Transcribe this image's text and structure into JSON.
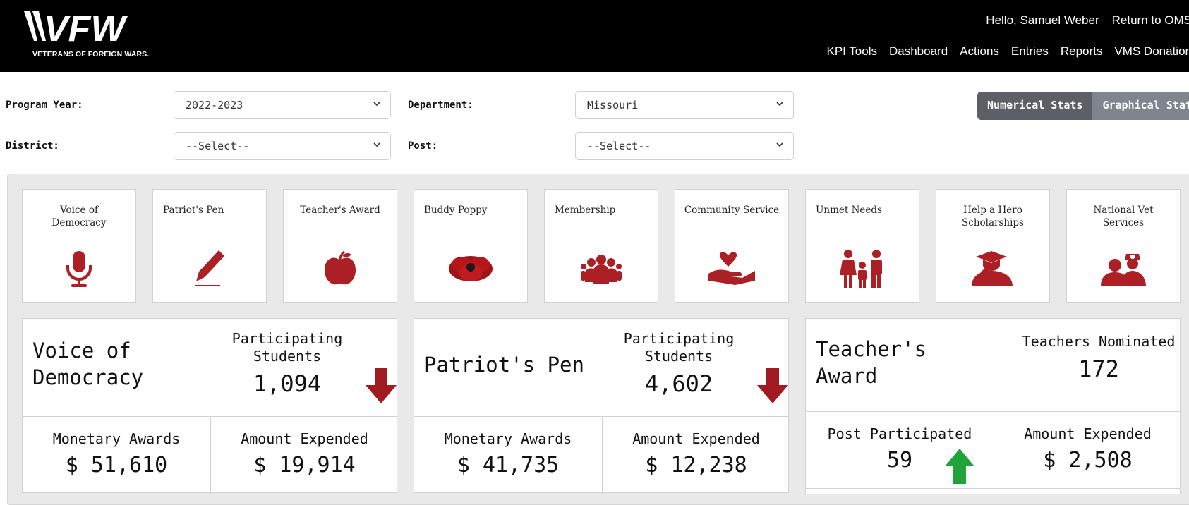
{
  "header": {
    "logo_text": "VFW",
    "logo_subtitle": "VETERANS OF FOREIGN WARS.",
    "user_links": [
      "Hello, Samuel Weber",
      "Return to OMS"
    ],
    "nav": [
      "KPI Tools",
      "Dashboard",
      "Actions",
      "Entries",
      "Reports",
      "VMS Donation"
    ]
  },
  "filters": {
    "program_year_label": "Program Year:",
    "program_year_value": "2022-2023",
    "department_label": "Department:",
    "department_value": "Missouri",
    "district_label": "District:",
    "district_value": "--Select--",
    "post_label": "Post:",
    "post_value": "--Select--"
  },
  "view_toggle": {
    "numerical": "Numerical Stats",
    "graphical": "Graphical Stats",
    "active": "numerical"
  },
  "colors": {
    "accent": "#ab1f25",
    "header_bg": "#000000",
    "panel_bg": "#e9e9e9",
    "up_arrow": "#1fa33a",
    "down_arrow": "#a11a1f"
  },
  "programs": [
    {
      "label": "Voice of Democracy",
      "icon": "microphone-icon"
    },
    {
      "label": "Patriot's Pen",
      "icon": "pen-icon"
    },
    {
      "label": "Teacher's Award",
      "icon": "apple-icon"
    },
    {
      "label": "Buddy Poppy",
      "icon": "poppy-icon"
    },
    {
      "label": "Membership",
      "icon": "group-icon"
    },
    {
      "label": "Community Service",
      "icon": "heart-hand-icon"
    },
    {
      "label": "Unmet Needs",
      "icon": "family-icon"
    },
    {
      "label": "Help a Hero Scholarships",
      "icon": "graduate-salute-icon"
    },
    {
      "label": "National Vet Services",
      "icon": "veteran-nurse-icon"
    }
  ],
  "cards": [
    {
      "title": "Voice of Democracy",
      "metric_label": "Participating Students",
      "metric_value": "1,094",
      "trend": "down",
      "bottom": [
        {
          "label": "Monetary Awards",
          "value": "$ 51,610"
        },
        {
          "label": "Amount Expended",
          "value": "$ 19,914"
        }
      ]
    },
    {
      "title": "Patriot's Pen",
      "metric_label": "Participating Students",
      "metric_value": "4,602",
      "trend": "down",
      "bottom": [
        {
          "label": "Monetary Awards",
          "value": "$ 41,735"
        },
        {
          "label": "Amount Expended",
          "value": "$ 12,238"
        }
      ]
    },
    {
      "title": "Teacher's Award",
      "metric_label": "Teachers Nominated",
      "metric_value": "172",
      "bottom": [
        {
          "label": "Post Participated",
          "value": "59",
          "trend": "up"
        },
        {
          "label": "Amount Expended",
          "value": "$ 2,508"
        }
      ]
    }
  ]
}
